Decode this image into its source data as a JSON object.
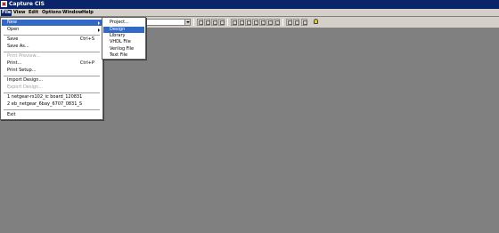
{
  "window": {
    "title": "Capture CIS"
  },
  "menubar": [
    {
      "label": "File"
    },
    {
      "label": "View"
    },
    {
      "label": "Edit"
    },
    {
      "label": "Options"
    },
    {
      "label": "Window"
    },
    {
      "label": "Help"
    }
  ],
  "file_menu": {
    "items": [
      {
        "label": "New",
        "has_submenu": true,
        "highlighted": true
      },
      {
        "label": "Open",
        "has_submenu": true
      },
      {
        "label": "Save",
        "shortcut": "Ctrl+S"
      },
      {
        "label": "Save As..."
      },
      {
        "label": "Print Preview...",
        "disabled": true
      },
      {
        "label": "Print...",
        "shortcut": "Ctrl+P"
      },
      {
        "label": "Print Setup..."
      },
      {
        "label": "Import Design..."
      },
      {
        "label": "Export Design...",
        "disabled": true
      },
      {
        "label": "1 netgear-rs102_ic board_120831"
      },
      {
        "label": "2 eb_netgear_6bay_6707_0831_S"
      },
      {
        "label": "Exit"
      }
    ]
  },
  "new_submenu": {
    "items": [
      {
        "label": "Project..."
      },
      {
        "label": "Design",
        "highlighted": true
      },
      {
        "label": "Library"
      },
      {
        "label": "VHDL File"
      },
      {
        "label": "Verilog File"
      },
      {
        "label": "Text File"
      }
    ]
  },
  "toolbar": {
    "combo_value": "",
    "buttons": [
      {
        "icon": "zoom-in-icon"
      },
      {
        "icon": "zoom-out-icon"
      },
      {
        "icon": "zoom-area-icon"
      },
      {
        "icon": "zoom-all-icon"
      },
      {
        "icon": "grid-icon"
      },
      {
        "icon": "annotate-icon"
      },
      {
        "icon": "back-annotate-icon"
      },
      {
        "icon": "drc-icon"
      },
      {
        "icon": "netlist-icon"
      },
      {
        "icon": "cross-reference-icon"
      },
      {
        "icon": "bill-of-materials-icon"
      },
      {
        "icon": "snap-to-grid-icon"
      },
      {
        "icon": "area-select-icon"
      },
      {
        "icon": "help-icon"
      },
      {
        "icon": "lamp-icon"
      }
    ]
  },
  "colors": {
    "titlebar": "#0a246a",
    "menu_highlight": "#3169c6",
    "workspace": "#808080",
    "chrome": "#d4d0c8"
  }
}
